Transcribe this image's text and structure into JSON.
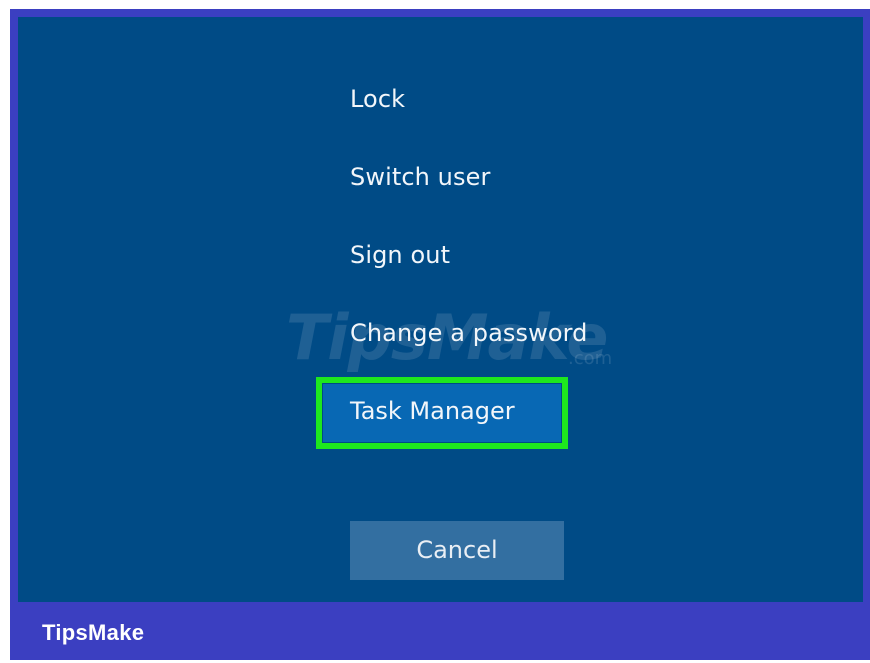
{
  "menu": {
    "items": [
      {
        "label": "Lock"
      },
      {
        "label": "Switch user"
      },
      {
        "label": "Sign out"
      },
      {
        "label": "Change a password"
      },
      {
        "label": "Task Manager"
      }
    ],
    "highlighted_item": "Task Manager",
    "highlight_color": "#1ee81e"
  },
  "cancel_button": {
    "label": "Cancel"
  },
  "watermark": {
    "text": "TipsMake",
    "suffix": ".com"
  },
  "brand": {
    "name": "TipsMake"
  },
  "colors": {
    "screen_background": "#004b86",
    "border": "#3b3fc1",
    "selected_item": "#0868b4",
    "cancel_background": "#336fa1"
  }
}
